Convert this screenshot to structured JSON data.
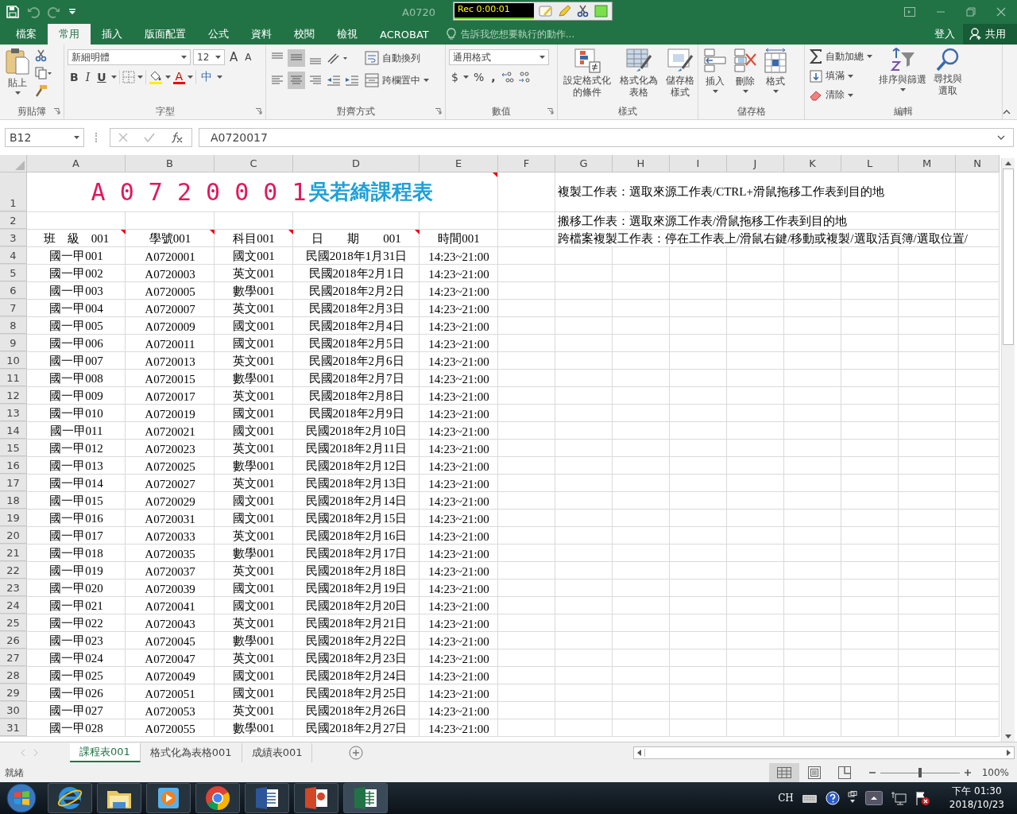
{
  "title_bar": {
    "title": "A0720"
  },
  "recorder": {
    "label": "Rec 0:00:01"
  },
  "menu_tabs": [
    {
      "label": "檔案",
      "selected": false
    },
    {
      "label": "常用",
      "selected": true
    },
    {
      "label": "插入",
      "selected": false
    },
    {
      "label": "版面配置",
      "selected": false
    },
    {
      "label": "公式",
      "selected": false
    },
    {
      "label": "資料",
      "selected": false
    },
    {
      "label": "校閱",
      "selected": false
    },
    {
      "label": "檢視",
      "selected": false
    },
    {
      "label": "ACROBAT",
      "selected": false
    }
  ],
  "tell_me": {
    "placeholder": "告訴我您想要執行的動作..."
  },
  "account": {
    "sign_in": "登入",
    "share": "共用"
  },
  "ribbon": {
    "clipboard": {
      "paste": "貼上",
      "label": "剪貼簿"
    },
    "font": {
      "name": "新細明體",
      "size": "12",
      "grow": "A",
      "shrink": "A",
      "bold": "B",
      "italic": "I",
      "underline": "U",
      "color_button": "A",
      "phonetic": "中",
      "label": "字型"
    },
    "alignment": {
      "wrap": "自動換列",
      "merge": "跨欄置中",
      "label": "對齊方式"
    },
    "number": {
      "format": "通用格式",
      "currency": "$",
      "percent": "%",
      "comma": ",",
      "label": "數值"
    },
    "styles": {
      "conditional": "設定格式化的條件",
      "table": "格式化為表格",
      "cell": "儲存格樣式",
      "label": "樣式"
    },
    "cells": {
      "insert": "插入",
      "delete": "刪除",
      "format": "格式",
      "label": "儲存格"
    },
    "editing": {
      "autosum": "自動加總",
      "fill": "填滿",
      "clear": "清除",
      "sort": "排序與篩選",
      "find": "尋找與選取",
      "label": "編輯"
    }
  },
  "formula_bar": {
    "name_box": "B12",
    "formula": "A0720017"
  },
  "sheet": {
    "columns": [
      "A",
      "B",
      "C",
      "D",
      "E",
      "F",
      "G",
      "H",
      "I",
      "J",
      "K",
      "L",
      "M",
      "N"
    ],
    "title": {
      "code": "A 0 7 2 0 0 0 1",
      "name": "吳若綺課程表",
      "comment": true
    },
    "notes": [
      {
        "number": "1",
        "text": "複製工作表：選取來源工作表/CTRL+滑鼠拖移工作表到目的地"
      },
      {
        "number": "2",
        "text": "搬移工作表：選取來源工作表/滑鼠拖移工作表到目的地"
      },
      {
        "number": "3",
        "text": "跨檔案複製工作表：停在工作表上/滑鼠右鍵/移動或複製/選取活頁簿/選取位置/"
      }
    ],
    "headers": [
      {
        "text": "班　級　001",
        "comment": true
      },
      {
        "text": "學號001",
        "comment": true
      },
      {
        "text": "科目001",
        "comment": true
      },
      {
        "text": "日　　期　　001",
        "comment": true
      },
      {
        "text": "時間001",
        "comment": false
      }
    ],
    "rows": [
      {
        "number": "4",
        "cells": [
          "國一甲001",
          "A0720001",
          "國文001",
          "民國2018年1月31日",
          "14:23~21:00"
        ]
      },
      {
        "number": "5",
        "cells": [
          "國一甲002",
          "A0720003",
          "英文001",
          "民國2018年2月1日",
          "14:23~21:00"
        ]
      },
      {
        "number": "6",
        "cells": [
          "國一甲003",
          "A0720005",
          "數學001",
          "民國2018年2月2日",
          "14:23~21:00"
        ]
      },
      {
        "number": "7",
        "cells": [
          "國一甲004",
          "A0720007",
          "英文001",
          "民國2018年2月3日",
          "14:23~21:00"
        ]
      },
      {
        "number": "8",
        "cells": [
          "國一甲005",
          "A0720009",
          "國文001",
          "民國2018年2月4日",
          "14:23~21:00"
        ]
      },
      {
        "number": "9",
        "cells": [
          "國一甲006",
          "A0720011",
          "國文001",
          "民國2018年2月5日",
          "14:23~21:00"
        ]
      },
      {
        "number": "10",
        "cells": [
          "國一甲007",
          "A0720013",
          "英文001",
          "民國2018年2月6日",
          "14:23~21:00"
        ]
      },
      {
        "number": "11",
        "cells": [
          "國一甲008",
          "A0720015",
          "數學001",
          "民國2018年2月7日",
          "14:23~21:00"
        ]
      },
      {
        "number": "12",
        "cells": [
          "國一甲009",
          "A0720017",
          "英文001",
          "民國2018年2月8日",
          "14:23~21:00"
        ]
      },
      {
        "number": "13",
        "cells": [
          "國一甲010",
          "A0720019",
          "國文001",
          "民國2018年2月9日",
          "14:23~21:00"
        ]
      },
      {
        "number": "14",
        "cells": [
          "國一甲011",
          "A0720021",
          "國文001",
          "民國2018年2月10日",
          "14:23~21:00"
        ]
      },
      {
        "number": "15",
        "cells": [
          "國一甲012",
          "A0720023",
          "英文001",
          "民國2018年2月11日",
          "14:23~21:00"
        ]
      },
      {
        "number": "16",
        "cells": [
          "國一甲013",
          "A0720025",
          "數學001",
          "民國2018年2月12日",
          "14:23~21:00"
        ]
      },
      {
        "number": "17",
        "cells": [
          "國一甲014",
          "A0720027",
          "英文001",
          "民國2018年2月13日",
          "14:23~21:00"
        ]
      },
      {
        "number": "18",
        "cells": [
          "國一甲015",
          "A0720029",
          "國文001",
          "民國2018年2月14日",
          "14:23~21:00"
        ]
      },
      {
        "number": "19",
        "cells": [
          "國一甲016",
          "A0720031",
          "國文001",
          "民國2018年2月15日",
          "14:23~21:00"
        ]
      },
      {
        "number": "20",
        "cells": [
          "國一甲017",
          "A0720033",
          "英文001",
          "民國2018年2月16日",
          "14:23~21:00"
        ]
      },
      {
        "number": "21",
        "cells": [
          "國一甲018",
          "A0720035",
          "數學001",
          "民國2018年2月17日",
          "14:23~21:00"
        ]
      },
      {
        "number": "22",
        "cells": [
          "國一甲019",
          "A0720037",
          "英文001",
          "民國2018年2月18日",
          "14:23~21:00"
        ]
      },
      {
        "number": "23",
        "cells": [
          "國一甲020",
          "A0720039",
          "國文001",
          "民國2018年2月19日",
          "14:23~21:00"
        ]
      },
      {
        "number": "24",
        "cells": [
          "國一甲021",
          "A0720041",
          "國文001",
          "民國2018年2月20日",
          "14:23~21:00"
        ]
      },
      {
        "number": "25",
        "cells": [
          "國一甲022",
          "A0720043",
          "英文001",
          "民國2018年2月21日",
          "14:23~21:00"
        ]
      },
      {
        "number": "26",
        "cells": [
          "國一甲023",
          "A0720045",
          "數學001",
          "民國2018年2月22日",
          "14:23~21:00"
        ]
      },
      {
        "number": "27",
        "cells": [
          "國一甲024",
          "A0720047",
          "英文001",
          "民國2018年2月23日",
          "14:23~21:00"
        ]
      },
      {
        "number": "28",
        "cells": [
          "國一甲025",
          "A0720049",
          "國文001",
          "民國2018年2月24日",
          "14:23~21:00"
        ]
      },
      {
        "number": "29",
        "cells": [
          "國一甲026",
          "A0720051",
          "國文001",
          "民國2018年2月25日",
          "14:23~21:00"
        ]
      },
      {
        "number": "30",
        "cells": [
          "國一甲027",
          "A0720053",
          "英文001",
          "民國2018年2月26日",
          "14:23~21:00"
        ]
      },
      {
        "number": "31",
        "cells": [
          "國一甲028",
          "A0720055",
          "數學001",
          "民國2018年2月27日",
          "14:23~21:00"
        ]
      }
    ]
  },
  "sheet_tabs": [
    {
      "label": "課程表001",
      "selected": true
    },
    {
      "label": "格式化為表格001",
      "selected": false
    },
    {
      "label": "成績表001",
      "selected": false
    }
  ],
  "status_bar": {
    "text": "就緒",
    "views": [
      {
        "kind": "normal",
        "selected": true
      },
      {
        "kind": "page_layout",
        "selected": false
      },
      {
        "kind": "page_break",
        "selected": false
      }
    ],
    "zoom": "100%",
    "level": 0.5
  },
  "taskbar": {
    "apps": [
      {
        "kind": "ie"
      },
      {
        "kind": "explorer"
      },
      {
        "kind": "media"
      },
      {
        "kind": "chrome"
      },
      {
        "kind": "word"
      },
      {
        "kind": "powerpoint"
      },
      {
        "kind": "excel"
      }
    ],
    "language": "CH",
    "time": "下午 01:30",
    "date": "2018/10/23"
  }
}
